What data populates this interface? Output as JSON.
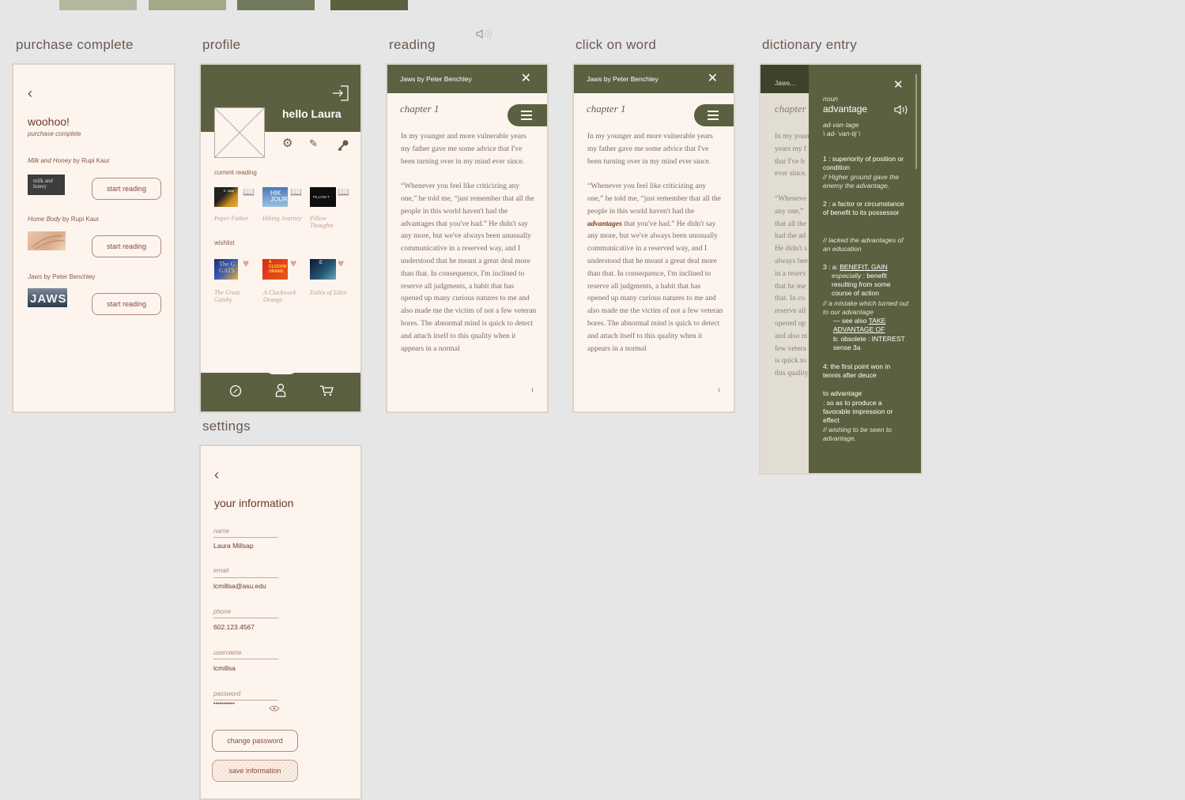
{
  "palette": [
    "#b4b69e",
    "#a4a887",
    "#717a5c",
    "#5b6140"
  ],
  "labels": {
    "purchase_complete": "purchase complete",
    "profile": "profile",
    "reading": "reading",
    "click_on_word": "click on word",
    "dictionary_entry": "dictionary entry",
    "settings": "settings"
  },
  "purchase": {
    "title": "woohoo!",
    "subtitle": "purchase complete",
    "books": [
      {
        "title": "Milk and Honey",
        "author": "by Rupi Kaur",
        "cover_text": "milk and honey",
        "button": "start reading"
      },
      {
        "title": "Home Body",
        "author": "by Rupi Kaur",
        "cover_text": "",
        "button": "start reading"
      },
      {
        "title": "Jaws",
        "author": "by Peter Benchley",
        "cover_text": "JAWS",
        "button": "start reading"
      }
    ]
  },
  "profile": {
    "greeting": "hello Laura",
    "current_reading_label": "current reading",
    "current_reading": [
      {
        "caption": "Paper Father",
        "cover_text": "E. Walt"
      },
      {
        "caption": "Hiking Journey",
        "cover_text": "HIK JOURN"
      },
      {
        "caption": "Pillow Thoughts",
        "cover_text": "PILLOW T"
      }
    ],
    "wishlist_label": "wishlist",
    "wishlist": [
      {
        "caption": "The Great Gatsby",
        "cover_text": "The G GATS"
      },
      {
        "caption": "A Clockwork Orange",
        "cover_text": "A CLOCKW ORANG"
      },
      {
        "caption": "Exiles of Eden",
        "cover_text": "E"
      }
    ]
  },
  "reading": {
    "header": "Jaws by Peter Benchley",
    "chapter": "chapter 1",
    "para1": "In my younger and more vulnerable years my father gave me some advice that I've been turning over in my mind ever since.",
    "para2a": "“Whenever you feel like criticizing any one,” he told me, “just remember that all the people in this world haven't had the ",
    "word": "advantages",
    "para2b": " that you've had.” He didn't say any more, but we've always been unusually communicative in a reserved way, and I understood that he meant a great deal more than that. In consequence, I'm inclined to reserve all judgments, a habit that has opened up many curious natures to me and also made me the victim of not a few veteran bores. The abnormal mind is quick to detect and attach itself to this quality when it appears in a normal",
    "page_number": "1"
  },
  "dictionary": {
    "header_short": "Jaws...",
    "chapter_short": "chapter",
    "bg_lines": [
      "In my youn",
      "years my f",
      "that I've b",
      "ever since.",
      "",
      "“Wheneve",
      "any one,”",
      "that all the",
      "had the ad",
      "He didn't s",
      "always bee",
      "in a reserv",
      "that he me",
      "that. In co",
      "reserve all",
      "opened up",
      "and also m",
      "few vetera",
      "is quick to",
      "this quality"
    ],
    "pos": "noun",
    "word": "advantage",
    "syllables": "ad·van·tage",
    "pronunciation": "\\ ad-ˈvan-tij \\",
    "def1": "1 : superiority of position or condition",
    "ex1": "// Higher ground gave the enemy the advantage.",
    "def2": "2 : a factor or circumstance of benefit to its possessor",
    "ex2": "// lacked the advantages of an education",
    "def3_prefix": "3 : a: ",
    "def3_link": "BENEFIT, GAIN",
    "def3_especially": "especially",
    "def3_rest": " : benefit resulting from some course of action",
    "ex3": "// a mistake which turned out to our advantage",
    "see_also_prefix": "— see also ",
    "see_also_link": "TAKE ADVANTAGE OF",
    "def3b": "b: obsolete : INTEREST sense 3a",
    "def4": "4: the first point won in tennis after deuce",
    "phrase": "to advantage",
    "phrase_def": ": so as to produce a favorable impression or effect",
    "phrase_ex": "// wishing to be seen to advantage."
  },
  "settings": {
    "title": "your information",
    "fields": [
      {
        "label": "name",
        "value": "Laura Millsap"
      },
      {
        "label": "email",
        "value": "lcmillsa@asu.edu"
      },
      {
        "label": "phone",
        "value": "602.123.4567"
      },
      {
        "label": "username",
        "value": "lcmillsa"
      },
      {
        "label": "password",
        "value": "•••••••••••"
      }
    ],
    "change_password": "change password",
    "save_information": "save information"
  }
}
